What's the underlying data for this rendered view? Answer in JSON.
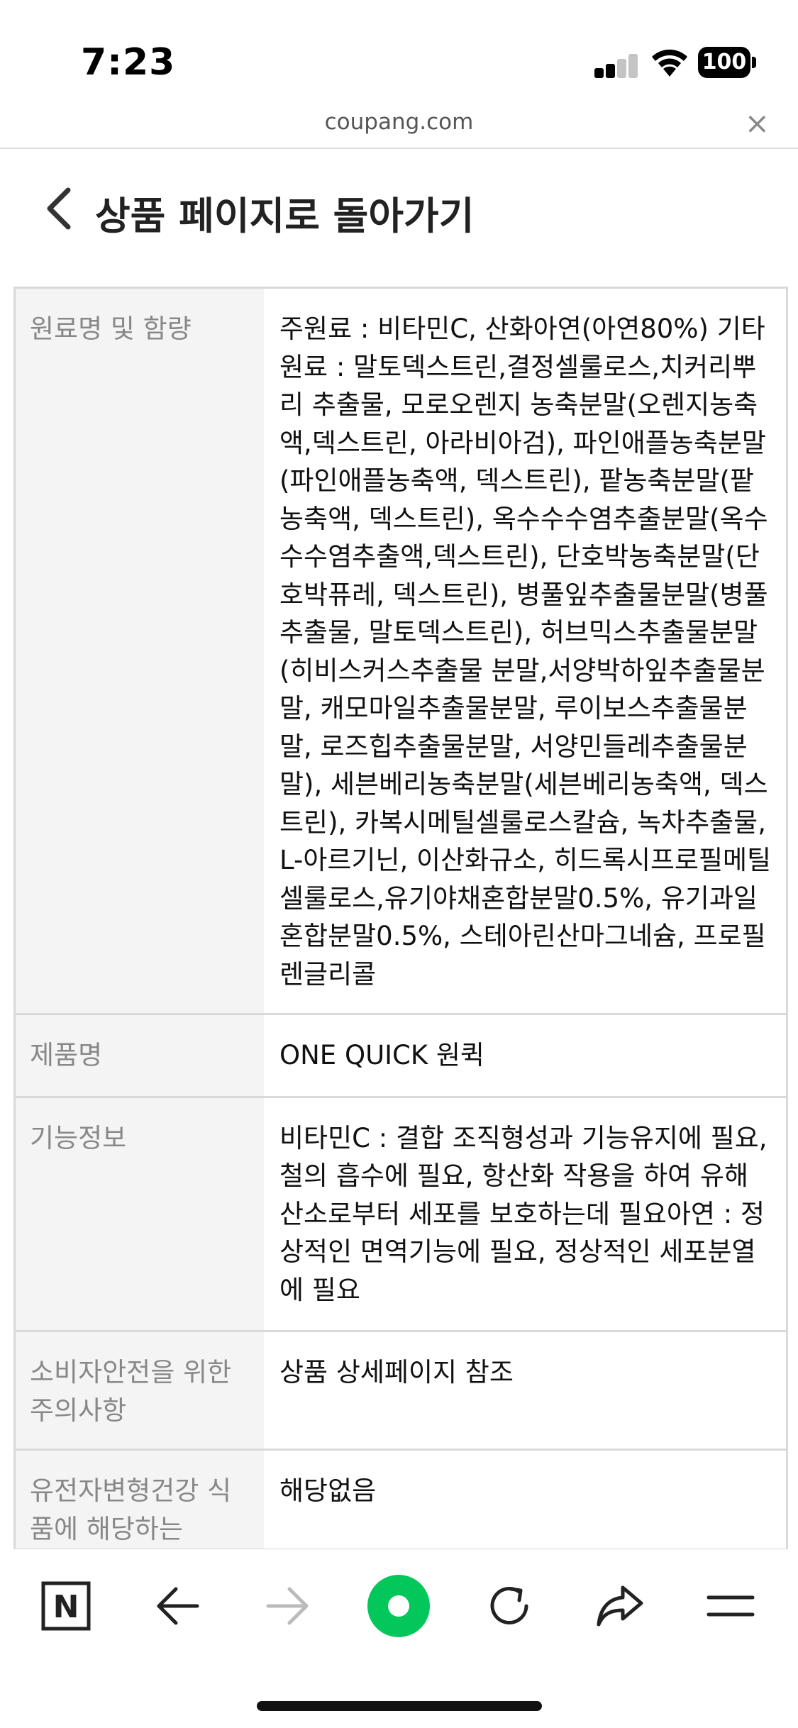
{
  "status_bar": {
    "time": "7:23",
    "battery": "100"
  },
  "url_bar": {
    "domain": "coupang.com",
    "close_symbol": "×"
  },
  "header": {
    "title": "상품 페이지로 돌아가기"
  },
  "table": {
    "rows": [
      {
        "label": "원료명 및 함량",
        "value": "주원료 : 비타민C, 산화아연(아연80%) 기타원료 : 말토덱스트린,결정셀룰로스,치커리뿌리 추출물, 모로오렌지 농축분말(오렌지농축액,덱스트린, 아라비아검), 파인애플농축분말(파인애플농축액, 덱스트린), 팥농축분말(팥농축액, 덱스트린), 옥수수수염추출분말(옥수수수염추출액,덱스트린), 단호박농축분말(단호박퓨레, 덱스트린), 병풀잎추출물분말(병풀추출물, 말토덱스트린), 허브믹스추출물분말(히비스커스추출물 분말,서양박하잎추출물분말, 캐모마일추출물분말, 루이보스추출물분말, 로즈힙추출물분말, 서양민들레추출물분말), 세븐베리농축분말(세븐베리농축액, 덱스트린), 카복시메틸셀룰로스칼슘, 녹차추출물, L-아르기닌, 이산화규소, 히드록시프로필메틸셀룰로스,유기야채혼합분말0.5%, 유기과일혼합분말0.5%, 스테아린산마그네슘, 프로필렌글리콜"
      },
      {
        "label": "제품명",
        "value": "ONE QUICK 원퀵"
      },
      {
        "label": "기능정보",
        "value": "비타민C : 결합 조직형성과 기능유지에 필요, 철의 흡수에 필요, 항산화 작용을 하여 유해산소로부터 세포를 보호하는데 필요아연 : 정상적인 면역기능에 필요, 정상적인 세포분열에 필요"
      },
      {
        "label": "소비자안전을 위한 주의사항",
        "value": "상품 상세페이지 참조"
      },
      {
        "label": "유전자변형건강 식품에 해당하는",
        "value": "해당없음"
      }
    ]
  },
  "toolbar": {
    "home_label": "N",
    "buttons": [
      "naver-home",
      "back",
      "forward",
      "green-dot",
      "reload",
      "share",
      "menu"
    ]
  },
  "colors": {
    "green_dot": "#03c75a",
    "border": "#d9d9d9",
    "label_bg": "#f4f4f4"
  }
}
